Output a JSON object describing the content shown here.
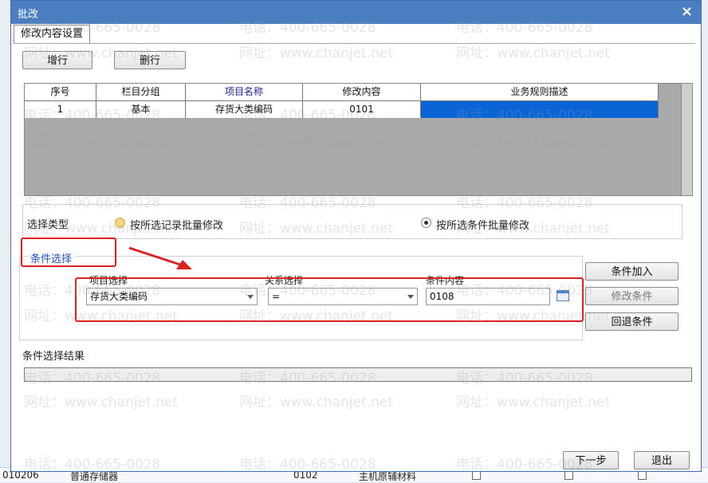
{
  "window": {
    "title": "批改",
    "close_glyph": "×"
  },
  "tab": {
    "label": "修改内容设置"
  },
  "toolbar": {
    "add_row": "增行",
    "delete_row": "删行"
  },
  "grid": {
    "headers": [
      "序号",
      "栏目分组",
      "项目名称",
      "修改内容",
      "业务规则描述"
    ],
    "rows": [
      [
        "1",
        "基本",
        "存货大类编码",
        "0101",
        ""
      ]
    ]
  },
  "select_type": {
    "label": "选择类型",
    "option1": "按所选记录批量修改",
    "option2": "按所选条件批量修改",
    "selected": "option2"
  },
  "condition": {
    "group_label": "条件选择",
    "item_label": "项目选择",
    "item_value": "存货大类编码",
    "relation_label": "关系选择",
    "relation_value": "=",
    "content_label": "条件内容",
    "content_value": "0108",
    "add_button": "条件加入",
    "modify_button": "修改条件",
    "rollback_button": "回退条件"
  },
  "result": {
    "label": "条件选择结果"
  },
  "footer": {
    "next_button": "下一步",
    "exit_button": "退出"
  },
  "background": {
    "code": "010206",
    "name": "普通存储器",
    "num": "0102",
    "material": "主机原辅材料"
  },
  "watermark": {
    "phone": "电话：400-665-0028",
    "site": "网址：www.chanjet.net"
  },
  "colors": {
    "title_bar": "#4a7ec1",
    "selection": "#0a64d6",
    "annotation": "#e02020",
    "group_label": "#2050c8"
  }
}
